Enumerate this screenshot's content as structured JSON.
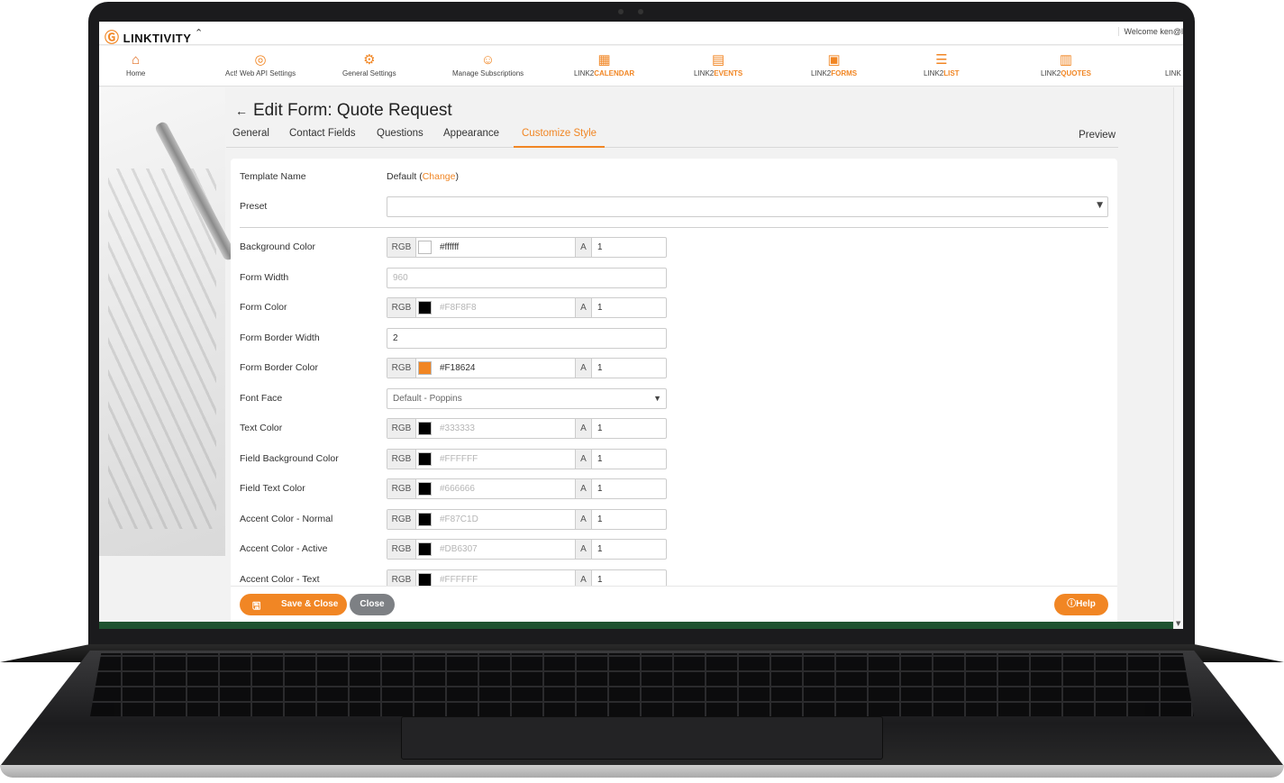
{
  "topbar": {
    "logo_text": "LINKTIVITY",
    "welcome": "Welcome ken@l"
  },
  "nav": [
    {
      "a": "Home",
      "b": "",
      "icon": "home-icon"
    },
    {
      "a": "Act! Web API Settings",
      "b": "",
      "icon": "globe-gear-icon"
    },
    {
      "a": "General Settings",
      "b": "",
      "icon": "gear-icon"
    },
    {
      "a": "Manage Subscriptions",
      "b": "",
      "icon": "user-gear-icon"
    },
    {
      "a": "LINK2",
      "b": "CALENDAR",
      "icon": "calendar-icon"
    },
    {
      "a": "LINK2",
      "b": "EVENTS",
      "icon": "events-icon"
    },
    {
      "a": "LINK2",
      "b": "FORMS",
      "icon": "forms-icon"
    },
    {
      "a": "LINK2",
      "b": "LIST",
      "icon": "list-icon"
    },
    {
      "a": "LINK2",
      "b": "QUOTES",
      "icon": "quotes-icon"
    },
    {
      "a": "LINK",
      "b": "",
      "icon": ""
    }
  ],
  "page": {
    "title": "Edit Form: Quote Request"
  },
  "tabs": [
    "General",
    "Contact Fields",
    "Questions",
    "Appearance",
    "Customize Style"
  ],
  "active_tab": "Customize Style",
  "preview_label": "Preview",
  "form": {
    "template_name_label": "Template Name",
    "template_value": "Default",
    "change_label": "Change",
    "preset_label": "Preset",
    "rgb_label": "RGB",
    "alpha_label": "A",
    "rows": [
      {
        "label": "Background Color",
        "kind": "color",
        "hex": "#ffffff",
        "swatch": "#ffffff",
        "alpha": "1",
        "placeholder": false
      },
      {
        "label": "Form Width",
        "kind": "text",
        "value": "960",
        "placeholder": true
      },
      {
        "label": "Form Color",
        "kind": "color",
        "hex": "#F8F8F8",
        "swatch": "#000000",
        "alpha": "1",
        "placeholder": true
      },
      {
        "label": "Form Border Width",
        "kind": "text",
        "value": "2",
        "placeholder": false
      },
      {
        "label": "Form Border Color",
        "kind": "color",
        "hex": "#F18624",
        "swatch": "#F18624",
        "alpha": "1",
        "placeholder": false
      },
      {
        "label": "Font Face",
        "kind": "select",
        "value": "Default - Poppins"
      },
      {
        "label": "Text Color",
        "kind": "color",
        "hex": "#333333",
        "swatch": "#000000",
        "alpha": "1",
        "placeholder": true
      },
      {
        "label": "Field Background Color",
        "kind": "color",
        "hex": "#FFFFFF",
        "swatch": "#000000",
        "alpha": "1",
        "placeholder": true
      },
      {
        "label": "Field Text Color",
        "kind": "color",
        "hex": "#666666",
        "swatch": "#000000",
        "alpha": "1",
        "placeholder": true
      },
      {
        "label": "Accent Color - Normal",
        "kind": "color",
        "hex": "#F87C1D",
        "swatch": "#000000",
        "alpha": "1",
        "placeholder": true
      },
      {
        "label": "Accent Color - Active",
        "kind": "color",
        "hex": "#DB6307",
        "swatch": "#000000",
        "alpha": "1",
        "placeholder": true
      },
      {
        "label": "Accent Color - Text",
        "kind": "color",
        "hex": "#FFFFFF",
        "swatch": "#000000",
        "alpha": "1",
        "placeholder": true
      }
    ]
  },
  "footer": {
    "save_label": "Save & Close",
    "close_label": "Close",
    "help_label": "Help"
  },
  "colors": {
    "accent": "#F18624",
    "green_bar": "#1f5230"
  }
}
